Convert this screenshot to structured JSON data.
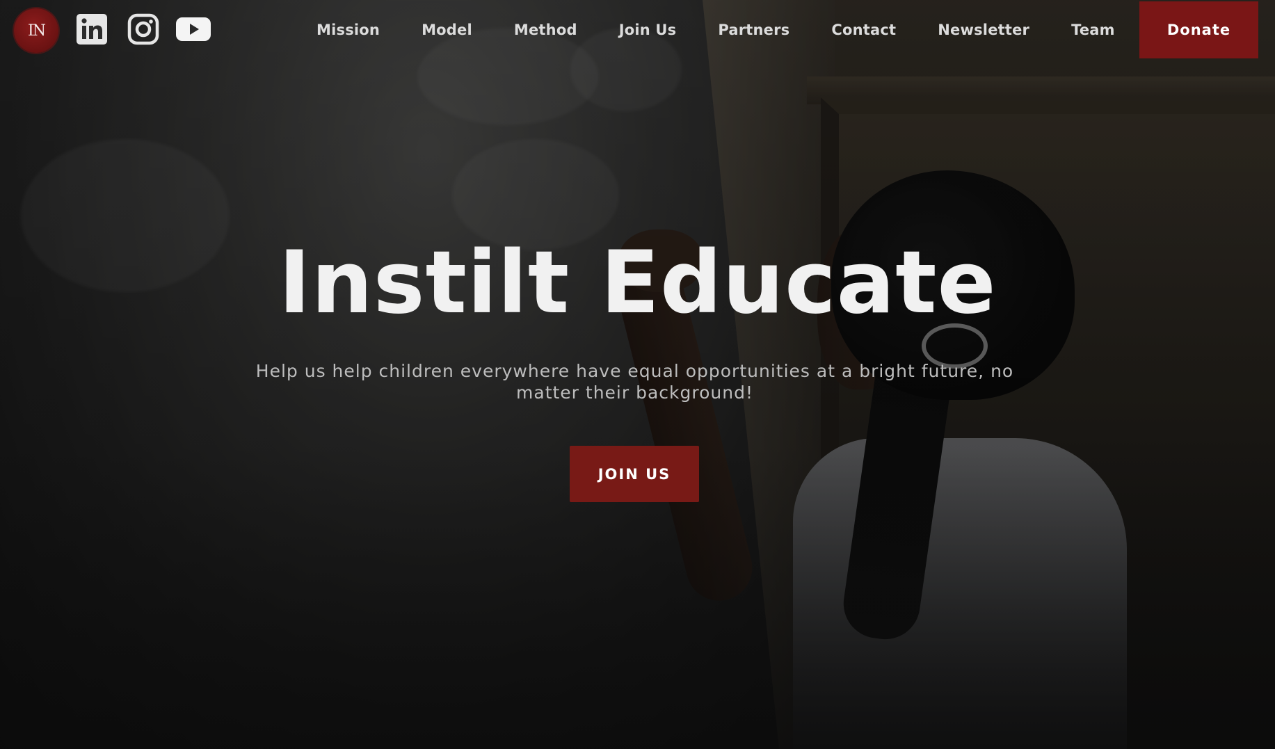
{
  "header": {
    "logo_text": "IN",
    "social": {
      "linkedin_icon": "linkedin-icon",
      "instagram_icon": "instagram-icon",
      "youtube_icon": "youtube-icon"
    },
    "nav": [
      {
        "label": "Mission"
      },
      {
        "label": "Model"
      },
      {
        "label": "Method"
      },
      {
        "label": "Join Us"
      },
      {
        "label": "Partners"
      },
      {
        "label": "Contact"
      },
      {
        "label": "Newsletter"
      },
      {
        "label": "Team"
      }
    ],
    "donate_label": "Donate"
  },
  "hero": {
    "title": "Instilt Educate",
    "subtitle": "Help us help children everywhere have equal opportunities at a bright future, no matter their background!",
    "cta_label": "JOIN US",
    "background_image": "girl-writing-on-chalkboard"
  },
  "colors": {
    "accent": "#7a1616",
    "nav_text": "#dcdcdc",
    "title_text": "#f1f1f1",
    "subtitle_text": "#bdbdbd"
  }
}
